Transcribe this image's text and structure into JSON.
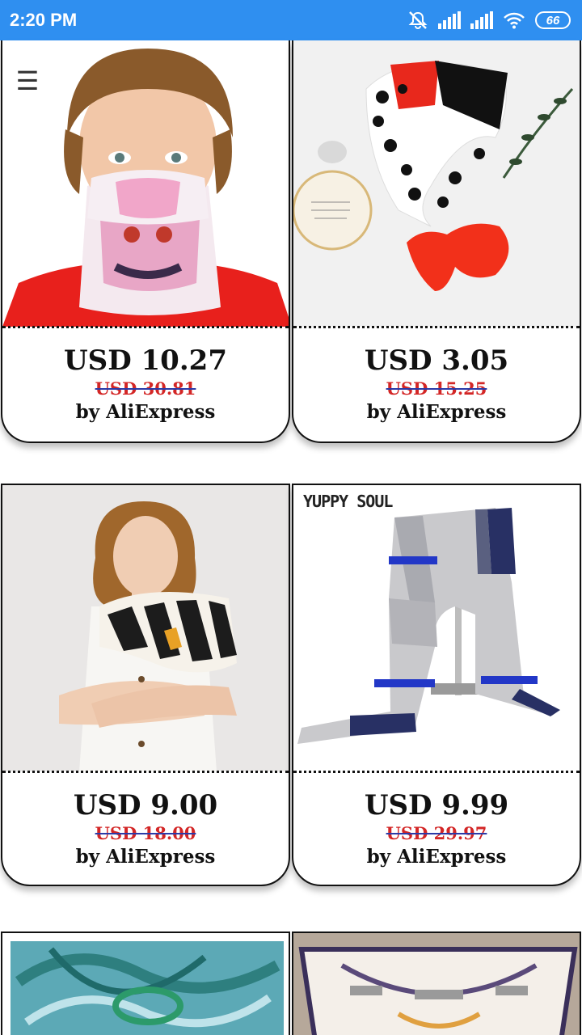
{
  "status_bar": {
    "time": "2:20 PM",
    "battery": "66",
    "icons": [
      "mute-icon",
      "signal-icon",
      "signal-icon",
      "wifi-icon",
      "battery-icon"
    ]
  },
  "menu": {
    "icon": "hamburger-icon",
    "glyph": "☰"
  },
  "products": [
    {
      "price": "USD 10.27",
      "old_price": "USD 30.81",
      "seller": "by AliExpress",
      "image": "boy wearing anime face mask"
    },
    {
      "price": "USD 3.05",
      "old_price": "USD 15.25",
      "seller": "by AliExpress",
      "image": "polka dot silk scarf with red bow"
    },
    {
      "price": "USD 9.00",
      "old_price": "USD 18.00",
      "seller": "by AliExpress",
      "image": "woman wearing striped scarf"
    },
    {
      "price": "USD 9.99",
      "old_price": "USD 29.97",
      "seller": "by AliExpress",
      "image": "grey plaid scarf on stand",
      "brand_text": "YUPPY SOUL"
    }
  ],
  "colors": {
    "status_bar": "#2f8ff0",
    "old_price": "#d32626",
    "strike": "#2a3aa8"
  }
}
